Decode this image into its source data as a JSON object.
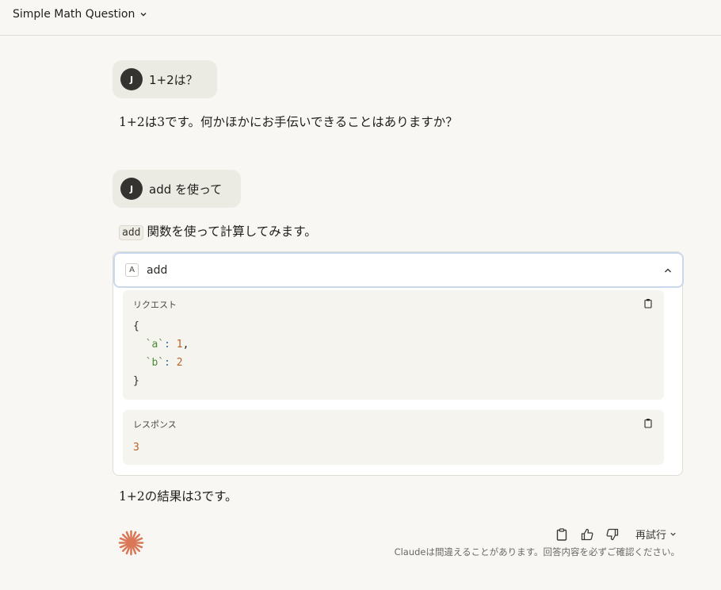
{
  "header": {
    "title": "Simple Math Question"
  },
  "messages": {
    "user1": {
      "avatar": "J",
      "text": "1+2は？"
    },
    "assistant1": {
      "text": "1+2は3です。何かほかにお手伝いできることはありますか？"
    },
    "user2": {
      "avatar": "J",
      "text": "add を使って"
    },
    "assistant2": {
      "code": "add",
      "text": "関数を使って計算してみます。"
    },
    "assistant3": {
      "text": "1+2の結果は3です。"
    }
  },
  "tool_call": {
    "letter": "A",
    "name": "add",
    "request": {
      "label": "リクエスト",
      "open": "{",
      "close": "}",
      "params": [
        {
          "key": "`a`",
          "value": "1",
          "comma": ","
        },
        {
          "key": "`b`",
          "value": "2",
          "comma": ""
        }
      ]
    },
    "response": {
      "label": "レスポンス",
      "value": "3"
    }
  },
  "footer": {
    "retry_label": "再試行",
    "disclaimer": "Claudeは間違えることがあります。回答内容を必ずご確認ください。"
  },
  "colors": {
    "accent": "#d97757",
    "focus_border": "#c9d9ec"
  },
  "icons": [
    "chevron-down-icon",
    "chevron-up-icon",
    "clipboard-icon",
    "thumbs-up-icon",
    "thumbs-down-icon",
    "claude-logo"
  ]
}
